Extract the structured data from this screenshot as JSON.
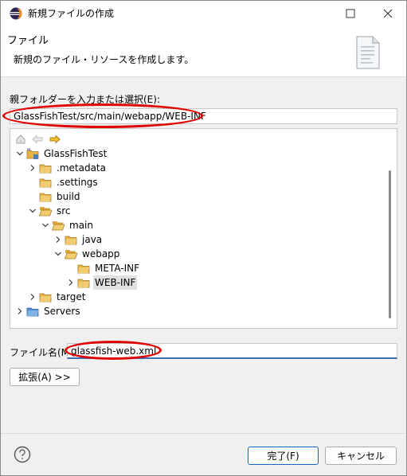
{
  "window": {
    "title": "新規ファイルの作成"
  },
  "banner": {
    "title": "ファイル",
    "description": "新規のファイル・リソースを作成します。"
  },
  "folder": {
    "label": "親フォルダーを入力または選択(E):",
    "value": "GlassFishTest/src/main/webapp/WEB-INF"
  },
  "tree": {
    "items": [
      {
        "label": "GlassFishTest",
        "type": "project",
        "expanded": true
      },
      {
        "label": ".metadata",
        "type": "folder",
        "expanded": false
      },
      {
        "label": ".settings",
        "type": "folder",
        "expanded": false
      },
      {
        "label": "build",
        "type": "folder",
        "expanded": false
      },
      {
        "label": "src",
        "type": "folder",
        "expanded": true
      },
      {
        "label": "main",
        "type": "folder",
        "expanded": true
      },
      {
        "label": "java",
        "type": "folder",
        "expanded": false
      },
      {
        "label": "webapp",
        "type": "folder",
        "expanded": true
      },
      {
        "label": "META-INF",
        "type": "folder",
        "expanded": false
      },
      {
        "label": "WEB-INF",
        "type": "folder",
        "expanded": false,
        "selected": true
      },
      {
        "label": "target",
        "type": "folder",
        "expanded": false
      },
      {
        "label": "Servers",
        "type": "folder-blue",
        "expanded": false
      }
    ]
  },
  "filename": {
    "label": "ファイル名(M):",
    "value": "glassfish-web.xml"
  },
  "advanced_button": "拡張(A) >>",
  "finish_button": "完了(F)",
  "cancel_button": "キャンセル",
  "colors": {
    "accent": "#0f67c4",
    "annotation": "#e00000",
    "folder": "#e8b44a"
  }
}
